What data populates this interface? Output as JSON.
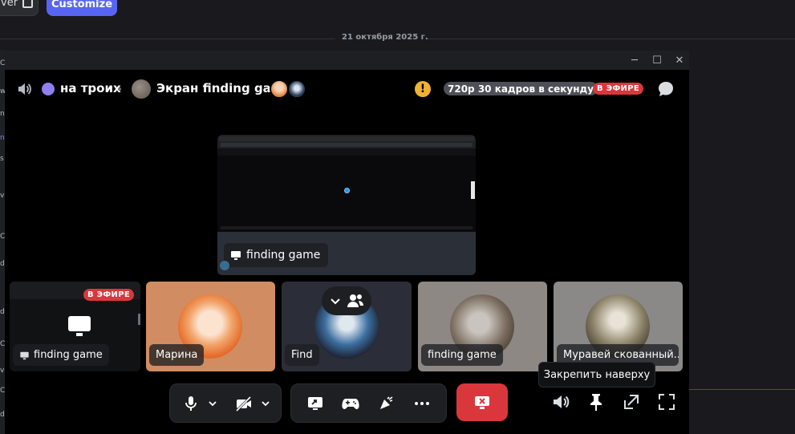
{
  "background": {
    "viewer_button_label": "ver",
    "customize_button_label": "Customize",
    "date_divider": "21 октября 2025 г.",
    "gutter_fragments": [
      "C",
      "w",
      "n",
      "n",
      "s",
      "ve",
      "C",
      "d",
      "d",
      "C",
      "ve",
      "C",
      "d"
    ]
  },
  "window": {
    "title_buttons": {
      "minimize": "─",
      "maximize": "☐",
      "close": "✕"
    }
  },
  "header": {
    "channel_name": "на троих",
    "stream_title": "Экран finding game",
    "quality": "720p 30 кадров в секунду",
    "live_badge": "В ЭФИРЕ",
    "warning_glyph": "!"
  },
  "main_stream": {
    "label": "finding game"
  },
  "tiles": [
    {
      "kind": "stream",
      "label": "finding game",
      "live_badge": "В ЭФИРЕ"
    },
    {
      "kind": "user",
      "label": "Марина"
    },
    {
      "kind": "user",
      "label": "Find"
    },
    {
      "kind": "user",
      "label": "finding game"
    },
    {
      "kind": "user",
      "label": "Муравей скованный..."
    }
  ],
  "tooltip": {
    "text": "Закрепить наверху"
  },
  "icons": {
    "header": [
      "speaker-icon",
      "status-dot",
      "streamer-avatar",
      "viewer-avatar-1",
      "viewer-avatar-2",
      "warning-icon",
      "chat-icon"
    ],
    "controls": [
      "microphone-icon",
      "chevron-down-icon",
      "camera-off-icon",
      "chevron-down-icon",
      "screen-share-icon",
      "gamepad-icon",
      "soundboard-icon",
      "more-icon",
      "end-call-icon",
      "volume-icon",
      "pin-icon",
      "popout-icon",
      "fullscreen-icon"
    ]
  },
  "colors": {
    "accent": "#5865f2",
    "live": "#da373c",
    "status_dot": "#8f7ff0",
    "warning": "#f0b232",
    "panel": "#1e1f22"
  }
}
